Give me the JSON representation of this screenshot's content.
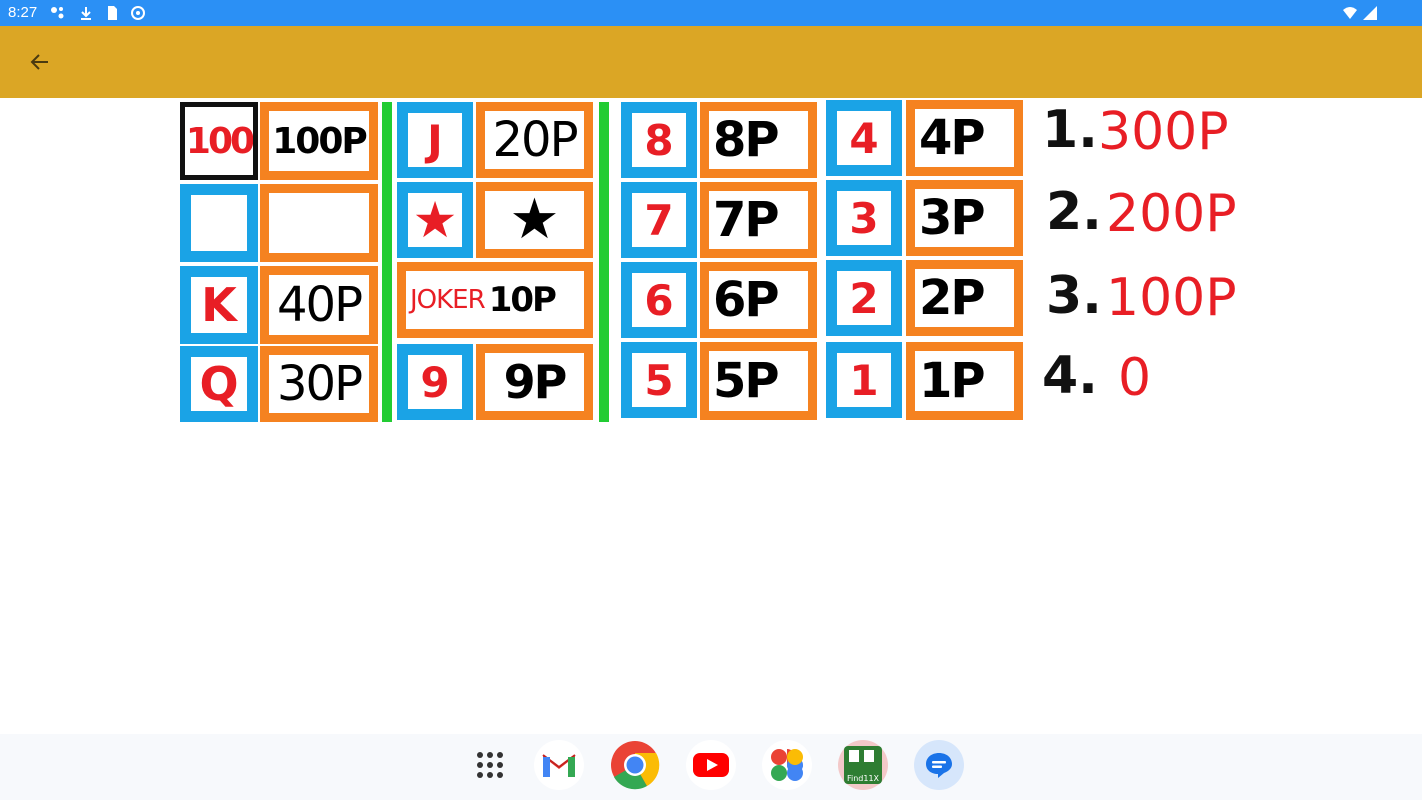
{
  "status_bar": {
    "time": "8:27"
  },
  "left_panel": {
    "rows": [
      {
        "key": "100",
        "value": "100P"
      },
      {
        "key": "",
        "value": ""
      },
      {
        "key": "K",
        "value": "40P"
      },
      {
        "key": "Q",
        "value": "30P"
      }
    ]
  },
  "mid_panel": {
    "rows": [
      {
        "key": "J",
        "value": "20P"
      },
      {
        "key": "★",
        "value": "★"
      },
      {
        "key": "JOKER",
        "value": "10P"
      },
      {
        "key": "9",
        "value": "9P"
      }
    ]
  },
  "num_panel_a": {
    "rows": [
      {
        "key": "8",
        "value": "8P"
      },
      {
        "key": "7",
        "value": "7P"
      },
      {
        "key": "6",
        "value": "6P"
      },
      {
        "key": "5",
        "value": "5P"
      }
    ]
  },
  "num_panel_b": {
    "rows": [
      {
        "key": "4",
        "value": "4P"
      },
      {
        "key": "3",
        "value": "3P"
      },
      {
        "key": "2",
        "value": "2P"
      },
      {
        "key": "1",
        "value": "1P"
      }
    ]
  },
  "ranking": [
    {
      "place": "1.",
      "prize": "300P"
    },
    {
      "place": "2.",
      "prize": "200P"
    },
    {
      "place": "3.",
      "prize": "100P"
    },
    {
      "place": "4.",
      "prize": "0"
    }
  ],
  "dock": {
    "items": [
      "apps-grid-icon",
      "gmail-icon",
      "chrome-icon",
      "youtube-icon",
      "photos-icon",
      "find11x-app-icon",
      "messages-icon"
    ],
    "find11x_label": "Find11X"
  },
  "colors": {
    "status_bar": "#2b90f5",
    "app_bar": "#dba625",
    "blue_frame": "#1aa3e6",
    "orange_frame": "#f58220",
    "red": "#e81e25",
    "divider": "#22cc33"
  }
}
